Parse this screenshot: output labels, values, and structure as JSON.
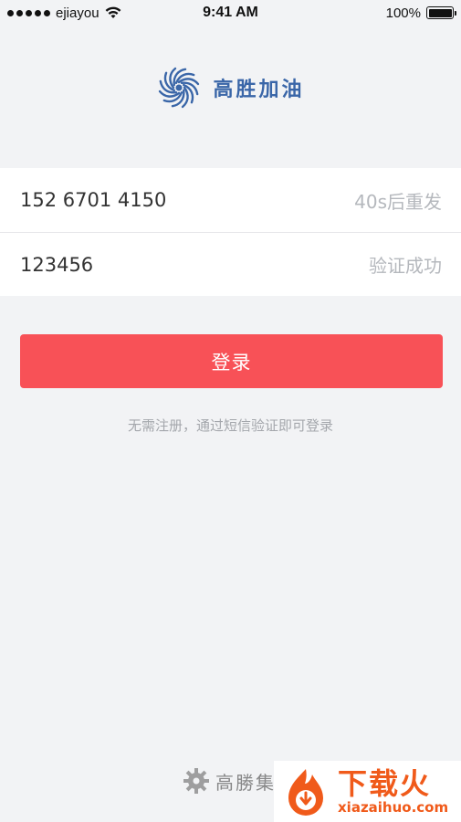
{
  "status_bar": {
    "carrier": "ejiayou",
    "time": "9:41 AM",
    "battery": "100%"
  },
  "app": {
    "logo_text": "高胜加油"
  },
  "form": {
    "phone_value": "152 6701 4150",
    "resend_label": "40s后重发",
    "code_value": "123456",
    "verify_status": "验证成功"
  },
  "login_button": {
    "label": "登录"
  },
  "hint": "无需注册，通过短信验证即可登录",
  "footer": {
    "logo_text": "高勝集"
  },
  "watermark": {
    "main": "下载火",
    "sub": "xiazaihuo.com"
  },
  "colors": {
    "background": "#f2f3f5",
    "button": "#f85157",
    "brand_blue": "#3a66a8",
    "watermark_orange": "#f05a1a"
  }
}
